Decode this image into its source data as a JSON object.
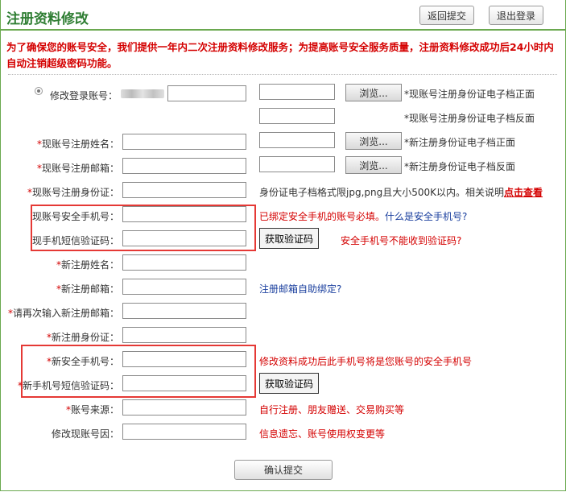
{
  "header": {
    "title": "注册资料修改",
    "back_label": "返回提交",
    "logout_label": "退出登录"
  },
  "notice": "为了确保您的账号安全，我们提供一年内二次注册资料修改服务；为提高账号安全服务质量，注册资料修改成功后24小时内自动注销超级密码功能。",
  "form": {
    "modify_account_label": "修改登录账号：",
    "id_front_old": "*现账号注册身份证电子档正面",
    "id_back_old": "*现账号注册身份证电子档反面",
    "id_front_new": "*新注册身份证电子档正面",
    "id_back_new": "*新注册身份证电子档反面",
    "browse_label": "浏览...",
    "cur_name_label": "现账号注册姓名：",
    "cur_email_label": "现账号注册邮箱：",
    "cur_id_label": "现账号注册身份证：",
    "id_note": "身份证电子档格式限jpg,png且大小500K以内。相关说明",
    "id_note_link": "点击查看",
    "cur_phone_label": "现账号安全手机号：",
    "cur_phone_note": "已绑定安全手机的账号必填。",
    "cur_phone_link": "什么是安全手机号?",
    "cur_sms_label": "现手机短信验证码：",
    "get_code_label": "获取验证码",
    "cur_sms_note": "安全手机号不能收到验证码?",
    "new_name_label": "新注册姓名：",
    "new_email_label": "新注册邮箱：",
    "new_email_note": "注册邮箱自助绑定?",
    "new_email_confirm_label": "请再次输入新注册邮箱：",
    "new_id_label": "新注册身份证：",
    "new_phone_label": "新安全手机号：",
    "new_phone_note": "修改资料成功后此手机号将是您账号的安全手机号",
    "new_sms_label": "新手机号短信验证码：",
    "source_label": "账号来源：",
    "source_note": "自行注册、朋友赠送、交易购买等",
    "reason_label": "修改现账号因：",
    "reason_note": "信息遗忘、账号使用权变更等",
    "submit_label": "确认提交"
  },
  "colors": {
    "title_green": "#2e7d32",
    "notice_red": "#d40000",
    "link_blue": "#1a3f9e",
    "highlight_box": "#e53935"
  }
}
